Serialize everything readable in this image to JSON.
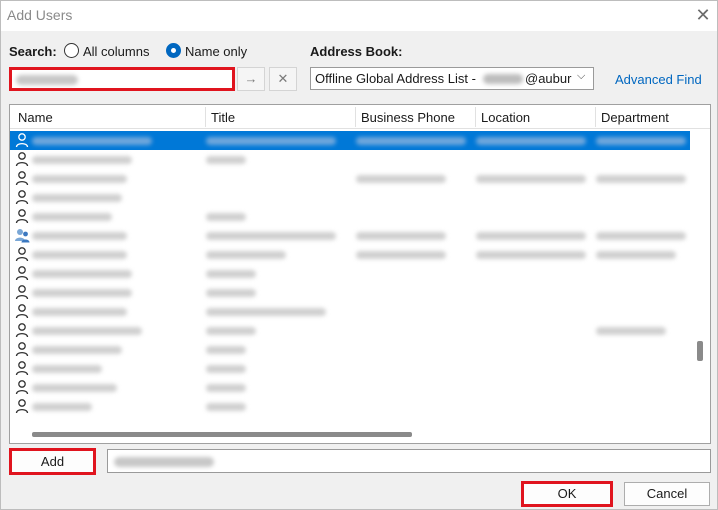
{
  "window": {
    "title": "Add Users",
    "close_glyph": "✕"
  },
  "search": {
    "label": "Search:",
    "options": [
      {
        "label": "All columns",
        "selected": false
      },
      {
        "label": "Name only",
        "selected": true
      }
    ],
    "go_glyph": "→",
    "clear_glyph": "✕"
  },
  "address_book": {
    "label": "Address Book:",
    "value_prefix": "Offline Global Address List -",
    "value_suffix": "@aubur",
    "chevron_glyph": "⌵",
    "advanced_find": "Advanced Find"
  },
  "table": {
    "columns": [
      "Name",
      "Title",
      "Business Phone",
      "Location",
      "Department"
    ],
    "rows": [
      {
        "icon": "person-icon",
        "selected": true
      },
      {
        "icon": "person-icon",
        "selected": false
      },
      {
        "icon": "person-icon",
        "selected": false
      },
      {
        "icon": "person-icon",
        "selected": false
      },
      {
        "icon": "person-icon",
        "selected": false
      },
      {
        "icon": "group-icon",
        "selected": false
      },
      {
        "icon": "person-icon",
        "selected": false
      },
      {
        "icon": "person-icon",
        "selected": false
      },
      {
        "icon": "person-icon",
        "selected": false
      },
      {
        "icon": "person-icon",
        "selected": false
      },
      {
        "icon": "person-icon",
        "selected": false
      },
      {
        "icon": "person-icon",
        "selected": false
      },
      {
        "icon": "person-icon",
        "selected": false
      },
      {
        "icon": "person-icon",
        "selected": false
      },
      {
        "icon": "person-icon",
        "selected": false
      }
    ]
  },
  "footer": {
    "add_label": "Add",
    "ok_label": "OK",
    "cancel_label": "Cancel"
  },
  "colors": {
    "highlight": "#e0141e",
    "selection": "#0078d7",
    "link": "#0067c0"
  }
}
